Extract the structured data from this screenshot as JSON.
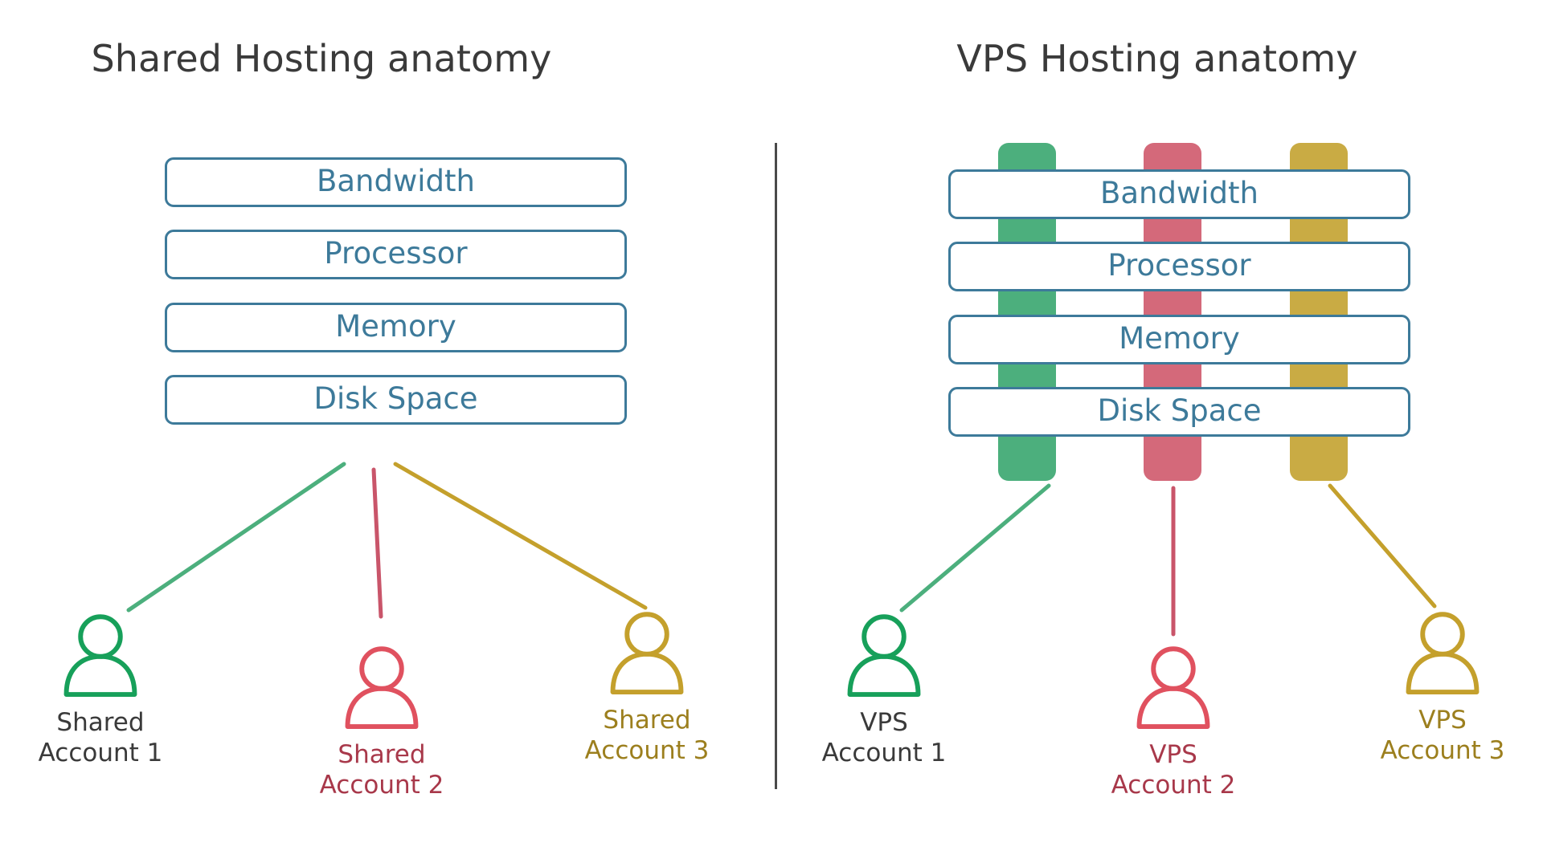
{
  "panels": [
    {
      "id": "shared",
      "title": "Shared Hosting anatomy",
      "resources": [
        {
          "label": "Bandwidth"
        },
        {
          "label": "Processor"
        },
        {
          "label": "Memory"
        },
        {
          "label": "Disk Space"
        }
      ],
      "accounts": [
        {
          "label": "Shared\nAccount 1",
          "color": "#17a05a",
          "line_color": "#4caf7d",
          "label_color": "#3a3a3a"
        },
        {
          "label": "Shared\nAccount 2",
          "color": "#e0515f",
          "line_color": "#c9556a",
          "label_color": "#a8384a"
        },
        {
          "label": "Shared\nAccount 3",
          "color": "#c4a02c",
          "line_color": "#c4a02c",
          "label_color": "#9c7f1e"
        }
      ]
    },
    {
      "id": "vps",
      "title": "VPS Hosting anatomy",
      "resources": [
        {
          "label": "Bandwidth"
        },
        {
          "label": "Processor"
        },
        {
          "label": "Memory"
        },
        {
          "label": "Disk Space"
        }
      ],
      "bars": [
        {
          "name": "vps-slice-green",
          "color": "#4caf7d"
        },
        {
          "name": "vps-slice-red",
          "color": "#d4697a"
        },
        {
          "name": "vps-slice-gold",
          "color": "#c9ab44"
        }
      ],
      "accounts": [
        {
          "label": "VPS\nAccount 1",
          "color": "#17a05a",
          "line_color": "#4caf7d",
          "label_color": "#3a3a3a"
        },
        {
          "label": "VPS\nAccount 2",
          "color": "#e0515f",
          "line_color": "#c9556a",
          "label_color": "#a8384a"
        },
        {
          "label": "VPS\nAccount 3",
          "color": "#c4a02c",
          "line_color": "#c4a02c",
          "label_color": "#9c7f1e"
        }
      ]
    }
  ],
  "theme": {
    "box_border": "#3d7a9a",
    "box_text": "#3d7a9a",
    "box_fill": "#ffffff",
    "title_color": "#3a3a3a",
    "divider_color": "#4a4a4a",
    "background": "#ffffff"
  }
}
